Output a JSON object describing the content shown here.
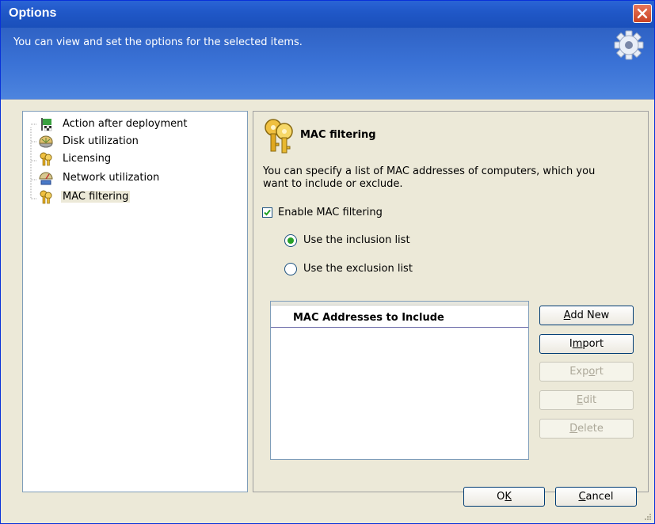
{
  "window": {
    "title": "Options",
    "header_text": "You can view and set the options for the selected items."
  },
  "tree": {
    "items": [
      {
        "label": "Action after deployment",
        "icon": "flag-icon"
      },
      {
        "label": "Disk utilization",
        "icon": "disk-icon"
      },
      {
        "label": "Licensing",
        "icon": "keys-icon"
      },
      {
        "label": "Network utilization",
        "icon": "network-icon"
      },
      {
        "label": "MAC filtering",
        "icon": "keys-icon",
        "selected": true
      }
    ]
  },
  "panel": {
    "title": "MAC filtering",
    "description": "You can specify a list of MAC addresses of computers, which you want to include or exclude.",
    "enable_label": "Enable MAC filtering",
    "enable_checked": true,
    "radio_inclusion": "Use the inclusion list",
    "radio_exclusion": "Use the exclusion list",
    "selected_radio": "inclusion",
    "list_header": "MAC Addresses to Include"
  },
  "buttons": {
    "add_new": {
      "accel": "A",
      "rest": "dd New",
      "enabled": true
    },
    "import": {
      "pre": "I",
      "accel": "m",
      "rest": "port",
      "enabled": true
    },
    "export": {
      "pre": "Exp",
      "accel": "o",
      "rest": "rt",
      "enabled": false
    },
    "edit": {
      "accel": "E",
      "rest": "dit",
      "enabled": false
    },
    "delete": {
      "accel": "D",
      "rest": "elete",
      "enabled": false
    },
    "ok": {
      "pre": "O",
      "accel": "K"
    },
    "cancel": {
      "accel": "C",
      "rest": "ancel"
    }
  },
  "colors": {
    "title_bar": "#2058c8",
    "header_band": "#3a72d6",
    "dialog_bg": "#ece9d8",
    "radio_dot": "#28a028",
    "checkbox_check": "#21a121"
  }
}
